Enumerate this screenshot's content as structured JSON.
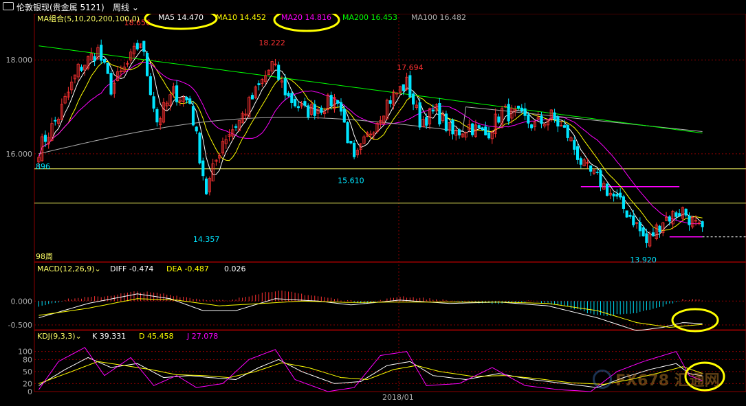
{
  "header": {
    "title": "伦敦银现(贵金属 5121)",
    "period": "周线"
  },
  "colors": {
    "up": "#ff3232",
    "down": "#00e5ff",
    "ma5": "#ffffff",
    "ma10": "#ffff00",
    "ma20": "#ff00ff",
    "ma200": "#00ff00",
    "ma100": "#b0b0b0",
    "grid": "#8b0000",
    "axis": "#aaaaaa",
    "highlight_ellipse": "#ffff00"
  },
  "legend": {
    "ma_group": "MA组合(5,10,20,200,100,0)",
    "items": [
      {
        "text": "MA5 14.470",
        "color": "#ffffff"
      },
      {
        "text": "MA10 14.452",
        "color": "#ffff00"
      },
      {
        "text": "MA20 14.816",
        "color": "#ff00ff"
      },
      {
        "text": "MA200 16.453",
        "color": "#00ff00"
      },
      {
        "text": "MA100 16.482",
        "color": "#b0b0b0"
      }
    ]
  },
  "macd_legend": {
    "title": "MACD(12,26,9)",
    "items": [
      {
        "text": "DIFF -0.474",
        "color": "#ffffff"
      },
      {
        "text": "DEA -0.487",
        "color": "#ffff00"
      },
      {
        "text": "0.026",
        "color": "#ffffff"
      }
    ]
  },
  "kdj_legend": {
    "title": "KDJ(9,3,3)",
    "items": [
      {
        "text": "K 39.331",
        "color": "#ffffff"
      },
      {
        "text": "D 45.458",
        "color": "#ffff00"
      },
      {
        "text": "J 27.078",
        "color": "#ff00ff"
      }
    ]
  },
  "labels": {
    "left_896": "896",
    "bar_count": "98周",
    "xaxis_date": "2018/01",
    "watermark": "FX678 汇通网"
  },
  "chart_data": [
    {
      "type": "candlestick",
      "ylim": [
        13.7,
        18.75
      ],
      "y_ticks": [
        18.0,
        16.0
      ],
      "y_tick_labels": [
        "18.000",
        "16.000"
      ],
      "annotations": [
        {
          "text": "18.656",
          "bar": 30,
          "value": 18.656,
          "color": "#ff3232"
        },
        {
          "text": "18.222",
          "bar": 71,
          "value": 18.222,
          "color": "#ff3232"
        },
        {
          "text": "17.694",
          "bar": 113,
          "value": 17.694,
          "color": "#ff3232"
        },
        {
          "text": "14.357",
          "bar": 51,
          "value": 14.357,
          "color": "#00e5ff"
        },
        {
          "text": "15.610",
          "bar": 95,
          "value": 15.61,
          "color": "#00e5ff"
        },
        {
          "text": "13.920",
          "bar": 184,
          "value": 13.92,
          "color": "#00e5ff"
        }
      ],
      "horizontal_lines": [
        {
          "value": 15.68,
          "color": "#ffff66"
        },
        {
          "value": 14.95,
          "color": "#ffff66"
        }
      ],
      "segments": [
        {
          "bar_from": 165,
          "bar_to": 195,
          "value": 15.3,
          "color": "#ff00ff"
        },
        {
          "bar_from": 192,
          "bar_to": 202,
          "value": 14.23,
          "color": "#ff00ff"
        }
      ],
      "anchors": [
        [
          0,
          16.1
        ],
        [
          6,
          16.8
        ],
        [
          12,
          17.8
        ],
        [
          18,
          18.2
        ],
        [
          22,
          17.4
        ],
        [
          27,
          17.9
        ],
        [
          31,
          18.4
        ],
        [
          36,
          16.7
        ],
        [
          41,
          17.3
        ],
        [
          46,
          17.1
        ],
        [
          51,
          15.2
        ],
        [
          56,
          16.3
        ],
        [
          61,
          16.7
        ],
        [
          66,
          17.3
        ],
        [
          71,
          17.9
        ],
        [
          76,
          17.2
        ],
        [
          81,
          16.9
        ],
        [
          86,
          17.0
        ],
        [
          91,
          17.2
        ],
        [
          96,
          15.8
        ],
        [
          101,
          16.5
        ],
        [
          106,
          17.1
        ],
        [
          112,
          17.5
        ],
        [
          116,
          16.7
        ],
        [
          121,
          16.9
        ],
        [
          126,
          16.4
        ],
        [
          131,
          16.6
        ],
        [
          136,
          16.4
        ],
        [
          141,
          16.9
        ],
        [
          146,
          16.8
        ],
        [
          151,
          16.6
        ],
        [
          156,
          16.8
        ],
        [
          161,
          16.4
        ],
        [
          166,
          15.7
        ],
        [
          171,
          15.4
        ],
        [
          176,
          15.0
        ],
        [
          181,
          14.6
        ],
        [
          185,
          14.1
        ],
        [
          190,
          14.6
        ],
        [
          196,
          14.8
        ],
        [
          202,
          14.3
        ]
      ]
    },
    {
      "type": "bar_line",
      "title": "MACD(12,26,9)",
      "ylim": [
        -0.6,
        0.55
      ],
      "y_ticks": [
        0.0,
        -0.5
      ],
      "y_tick_labels": [
        "0.000",
        "-0.500"
      ],
      "hist_anchors": [
        [
          0,
          -0.1
        ],
        [
          10,
          0.05
        ],
        [
          20,
          0.1
        ],
        [
          30,
          0.2
        ],
        [
          38,
          0.15
        ],
        [
          48,
          0.05
        ],
        [
          58,
          0.0
        ],
        [
          66,
          0.15
        ],
        [
          72,
          0.22
        ],
        [
          80,
          0.15
        ],
        [
          90,
          0.05
        ],
        [
          100,
          -0.05
        ],
        [
          110,
          0.1
        ],
        [
          118,
          0.05
        ],
        [
          130,
          -0.02
        ],
        [
          140,
          -0.05
        ],
        [
          150,
          0.0
        ],
        [
          160,
          -0.1
        ],
        [
          170,
          -0.3
        ],
        [
          180,
          -0.28
        ],
        [
          188,
          -0.15
        ],
        [
          196,
          0.03
        ],
        [
          202,
          0.026
        ]
      ],
      "diff_anchors": [
        [
          0,
          -0.35
        ],
        [
          15,
          -0.05
        ],
        [
          30,
          0.15
        ],
        [
          40,
          0.05
        ],
        [
          50,
          -0.2
        ],
        [
          60,
          -0.2
        ],
        [
          72,
          0.05
        ],
        [
          85,
          0.0
        ],
        [
          95,
          -0.08
        ],
        [
          110,
          0.02
        ],
        [
          125,
          -0.05
        ],
        [
          140,
          -0.02
        ],
        [
          155,
          -0.1
        ],
        [
          170,
          -0.35
        ],
        [
          182,
          -0.62
        ],
        [
          190,
          -0.55
        ],
        [
          196,
          -0.45
        ],
        [
          202,
          -0.474
        ]
      ],
      "dea_anchors": [
        [
          0,
          -0.3
        ],
        [
          15,
          -0.15
        ],
        [
          30,
          0.05
        ],
        [
          42,
          0.02
        ],
        [
          55,
          -0.1
        ],
        [
          68,
          -0.05
        ],
        [
          80,
          0.0
        ],
        [
          95,
          -0.03
        ],
        [
          110,
          -0.02
        ],
        [
          125,
          -0.02
        ],
        [
          140,
          -0.02
        ],
        [
          155,
          -0.05
        ],
        [
          170,
          -0.2
        ],
        [
          182,
          -0.45
        ],
        [
          192,
          -0.55
        ],
        [
          202,
          -0.487
        ]
      ]
    },
    {
      "type": "line",
      "title": "KDJ(9,3,3)",
      "ylim": [
        0,
        120
      ],
      "y_ticks": [
        100,
        80,
        50,
        20,
        0
      ],
      "y_tick_labels": [
        "100",
        "80",
        "50",
        "20",
        "0"
      ],
      "k_anchors": [
        [
          0,
          15
        ],
        [
          8,
          55
        ],
        [
          15,
          85
        ],
        [
          22,
          60
        ],
        [
          30,
          70
        ],
        [
          38,
          35
        ],
        [
          46,
          40
        ],
        [
          52,
          35
        ],
        [
          60,
          30
        ],
        [
          67,
          60
        ],
        [
          73,
          80
        ],
        [
          80,
          50
        ],
        [
          90,
          20
        ],
        [
          98,
          25
        ],
        [
          106,
          65
        ],
        [
          113,
          75
        ],
        [
          120,
          40
        ],
        [
          130,
          30
        ],
        [
          140,
          45
        ],
        [
          150,
          30
        ],
        [
          160,
          20
        ],
        [
          170,
          10
        ],
        [
          178,
          35
        ],
        [
          186,
          55
        ],
        [
          194,
          70
        ],
        [
          198,
          45
        ],
        [
          202,
          39.3
        ]
      ],
      "d_anchors": [
        [
          0,
          20
        ],
        [
          10,
          50
        ],
        [
          18,
          75
        ],
        [
          26,
          65
        ],
        [
          34,
          55
        ],
        [
          42,
          42
        ],
        [
          50,
          40
        ],
        [
          58,
          35
        ],
        [
          66,
          50
        ],
        [
          74,
          72
        ],
        [
          82,
          60
        ],
        [
          92,
          35
        ],
        [
          100,
          30
        ],
        [
          108,
          55
        ],
        [
          115,
          65
        ],
        [
          122,
          50
        ],
        [
          132,
          38
        ],
        [
          142,
          40
        ],
        [
          152,
          32
        ],
        [
          162,
          22
        ],
        [
          172,
          18
        ],
        [
          180,
          30
        ],
        [
          188,
          45
        ],
        [
          196,
          62
        ],
        [
          202,
          45.5
        ]
      ],
      "j_anchors": [
        [
          0,
          5
        ],
        [
          6,
          75
        ],
        [
          14,
          110
        ],
        [
          20,
          40
        ],
        [
          28,
          85
        ],
        [
          35,
          15
        ],
        [
          42,
          40
        ],
        [
          48,
          10
        ],
        [
          56,
          20
        ],
        [
          64,
          80
        ],
        [
          72,
          105
        ],
        [
          78,
          30
        ],
        [
          88,
          0
        ],
        [
          96,
          10
        ],
        [
          104,
          90
        ],
        [
          112,
          100
        ],
        [
          118,
          15
        ],
        [
          128,
          20
        ],
        [
          138,
          60
        ],
        [
          148,
          15
        ],
        [
          158,
          5
        ],
        [
          168,
          0
        ],
        [
          176,
          50
        ],
        [
          184,
          75
        ],
        [
          194,
          100
        ],
        [
          198,
          40
        ],
        [
          202,
          27.1
        ]
      ]
    }
  ]
}
